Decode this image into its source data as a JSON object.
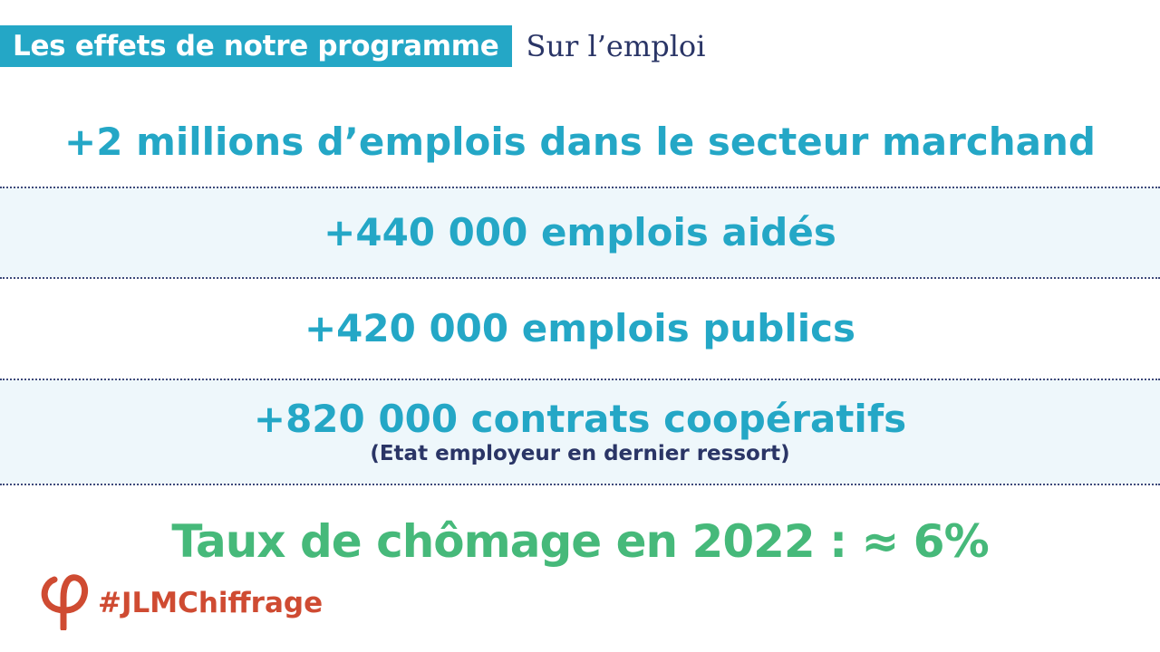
{
  "header": {
    "tag": "Les effets de notre programme",
    "subtitle": "Sur l’emploi"
  },
  "stats": [
    {
      "text": "+2 millions d’emplois dans le secteur marchand"
    },
    {
      "text": "+440 000 emplois aidés"
    },
    {
      "text": "+420 000 emplois publics"
    },
    {
      "text": "+820 000 contrats coopératifs",
      "note": "(Etat employeur en dernier ressort)"
    }
  ],
  "result": "Taux de chômage en 2022 : ≈ 6%",
  "footer": {
    "hashtag": "#JLMChiffrage",
    "logo_icon": "phi-logo-icon"
  },
  "colors": {
    "accent_blue": "#24a7c6",
    "navy": "#2a3566",
    "green": "#46b97a",
    "red": "#cf4b32",
    "band_tint": "#eef7fb"
  }
}
